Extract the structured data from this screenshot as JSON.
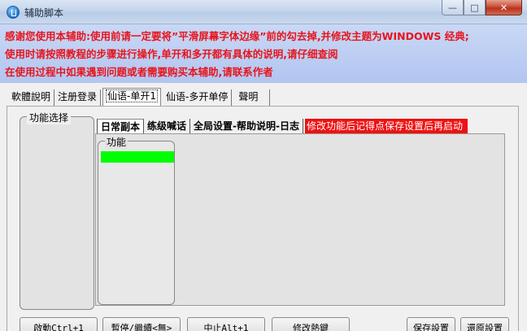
{
  "window": {
    "title": "辅助脚本",
    "min_glyph": "—",
    "max_glyph": "□",
    "close_glyph": "✕"
  },
  "notice": [
    "感谢您使用本辅助:使用前请一定要将”平滑屏幕字体边缘”前的勾去掉,并修改主题为WINDOWS 经典;",
    "使用时请按照教程的步骤进行操作,单开和多开都有具体的说明,请仔细查阅",
    "在使用过程中如果遇到问题或者需要购买本辅助,请联系作者"
  ],
  "outer_tabs": [
    "軟體說明",
    "注册登录",
    "仙语-单开1",
    "仙语-多开单停",
    "聲明"
  ],
  "group_label": "功能选择",
  "inner_tabs": [
    "日常副本",
    "练级喊话",
    "全局设置-帮助说明-日志"
  ],
  "inner_warning": "修改功能后记得点保存设置后再启动",
  "subgroup_label": "功能",
  "buttons": {
    "start": "啟動Ctrl+1",
    "pause": "暫停/繼續<無>",
    "stop": "中止Alt+1",
    "hotkey": "修改熱鍵",
    "save": "保存設置",
    "restore": "還原設置"
  },
  "colors": {
    "notice_text": "#e8141c",
    "notice_bg": "#b8caf2",
    "warning_bg": "#ee1111",
    "green_bar": "#00ff00"
  }
}
